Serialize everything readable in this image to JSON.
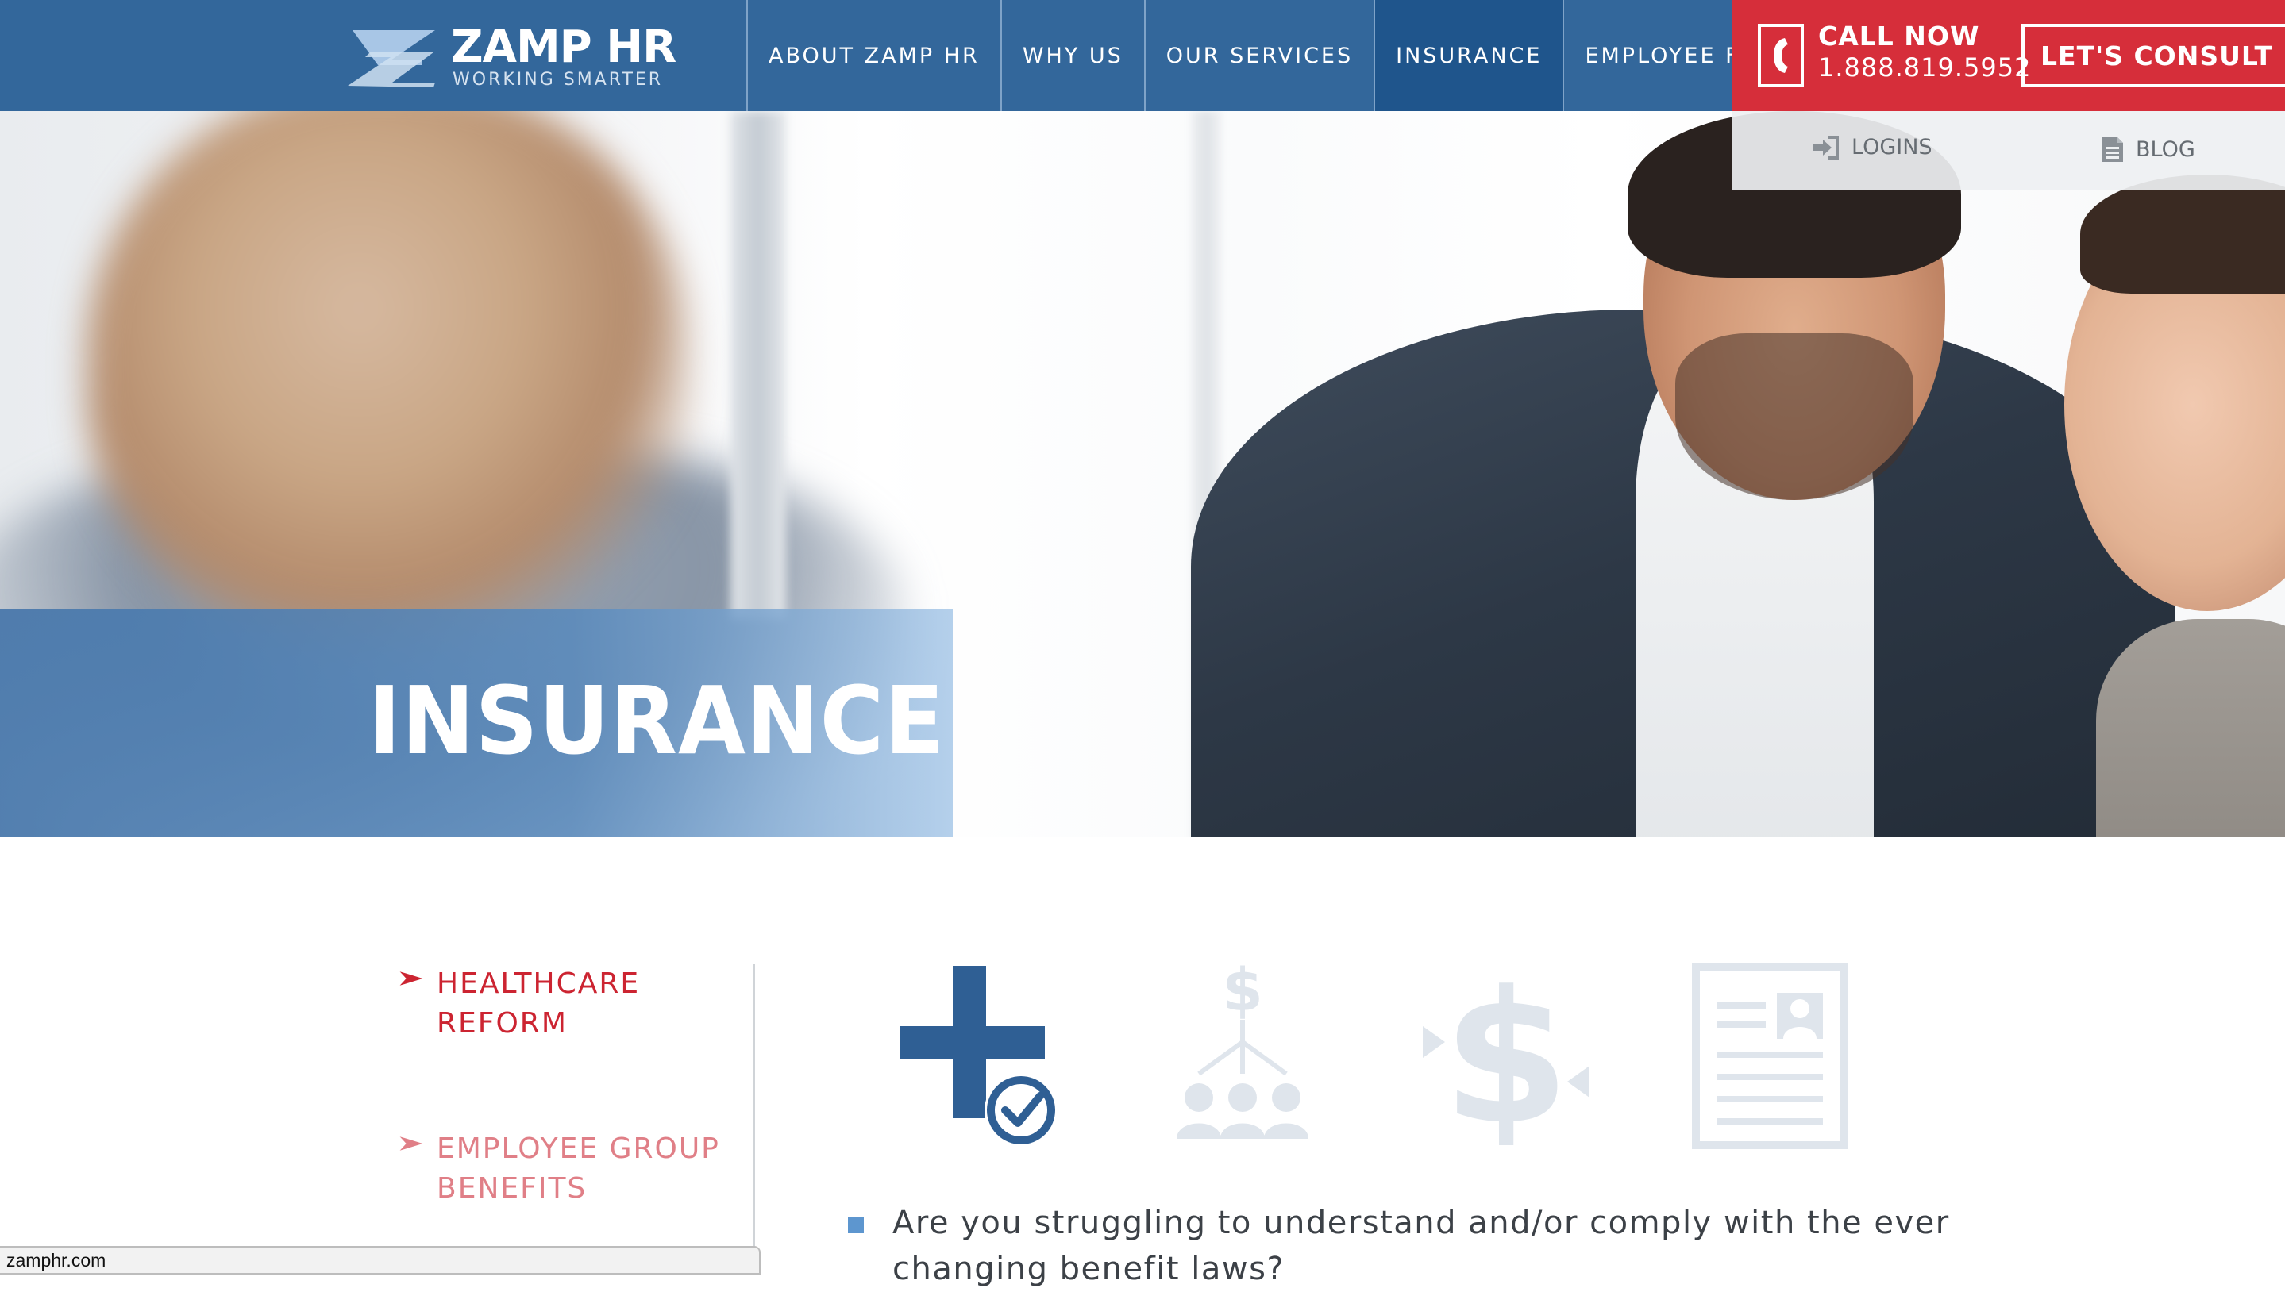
{
  "brand": {
    "name": "ZAMP HR",
    "tagline": "WORKING SMARTER"
  },
  "nav": {
    "items": [
      {
        "label": "ABOUT ZAMP HR",
        "active": false
      },
      {
        "label": "WHY US",
        "active": false
      },
      {
        "label": "OUR SERVICES",
        "active": false
      },
      {
        "label": "INSURANCE",
        "active": true
      },
      {
        "label": "EMPLOYEE FORMS",
        "active": false
      }
    ]
  },
  "cta": {
    "call_title": "CALL NOW",
    "call_number": "1.888.819.5952",
    "consult_label": "LET'S CONSULT",
    "consult_arrow": "➤"
  },
  "utility": {
    "logins_label": "LOGINS",
    "blog_label": "BLOG"
  },
  "hero": {
    "title": "INSURANCE"
  },
  "sidebar": {
    "items": [
      {
        "label": "HEALTHCARE REFORM",
        "active": true,
        "chevron": "➤"
      },
      {
        "label": "EMPLOYEE GROUP BENEFITS",
        "active": false,
        "chevron": "➤"
      }
    ]
  },
  "feature_icons": [
    {
      "icon": "medical-cross-check-icon",
      "active": true
    },
    {
      "icon": "dollar-people-icon",
      "active": false
    },
    {
      "icon": "dollar-arrows-icon",
      "active": false
    },
    {
      "icon": "document-profile-icon",
      "active": false
    }
  ],
  "content": {
    "question": "Are you struggling to understand and/or comply with the ever changing benefit laws?"
  },
  "status_bar": {
    "url": "zamphr.com"
  },
  "colors": {
    "header_blue": "#33679b",
    "nav_active": "#1f558c",
    "cta_red": "#d62e3a",
    "link_red": "#cc2431",
    "link_pink": "#e07f87",
    "icon_active": "#2f5f94",
    "icon_inactive": "#dfe5ec",
    "bullet_blue": "#5d96cf"
  }
}
